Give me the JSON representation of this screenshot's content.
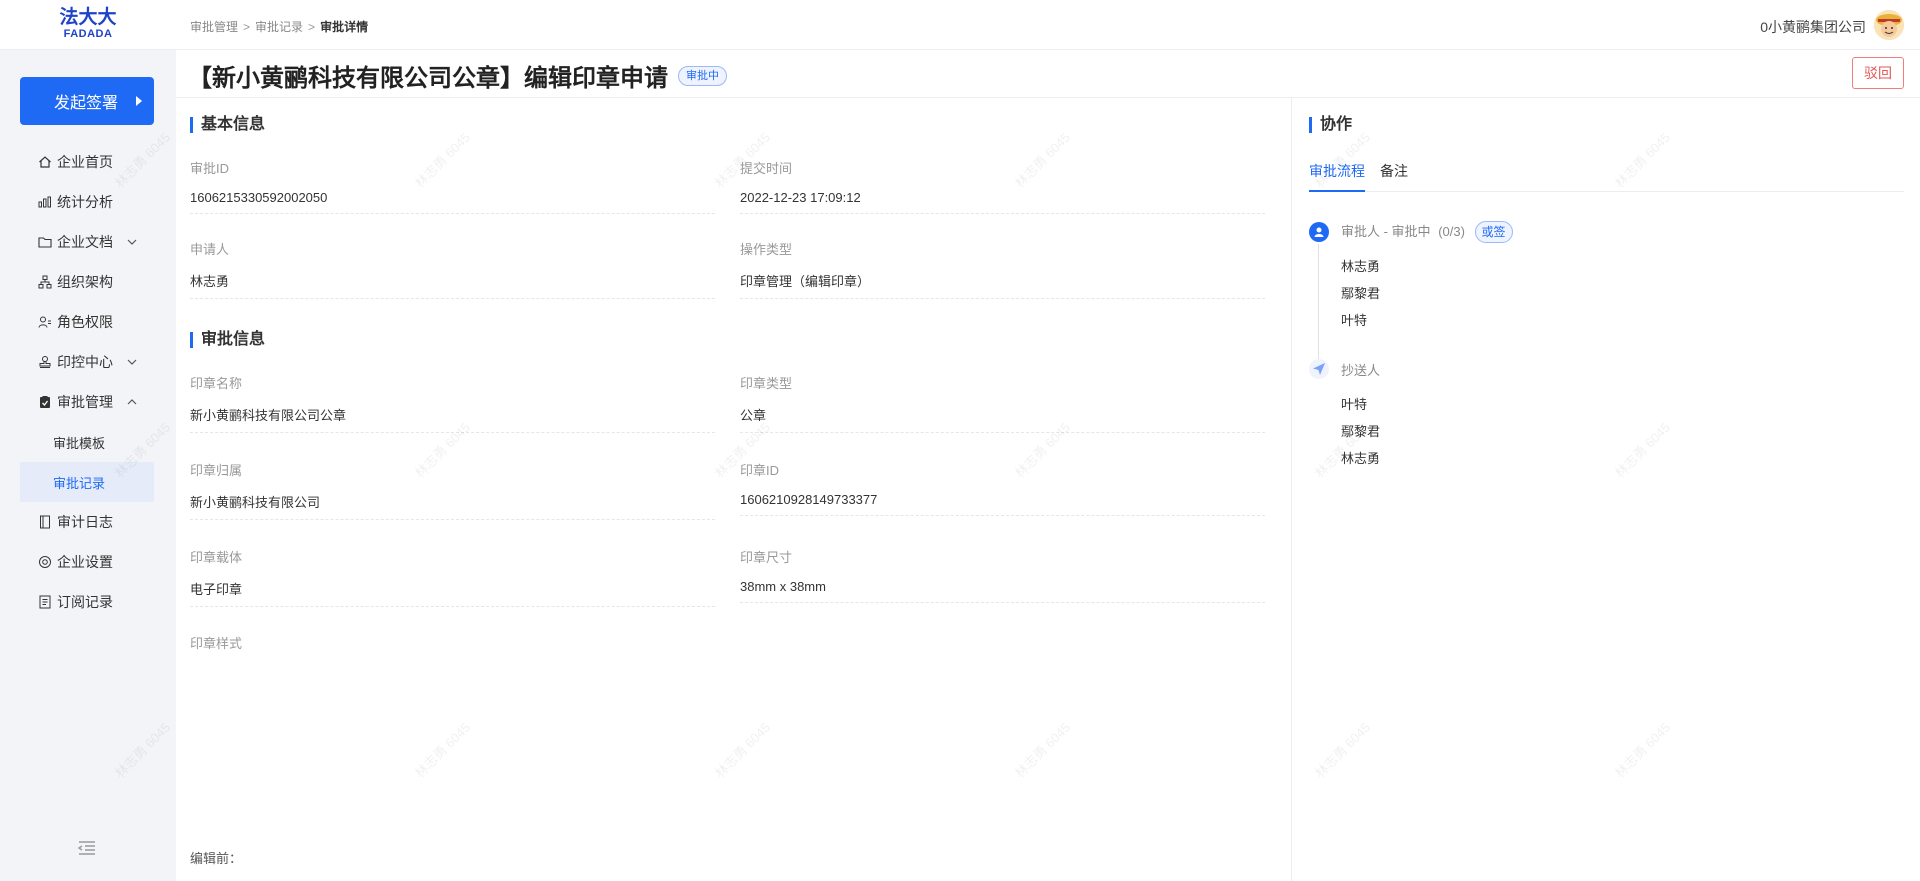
{
  "brand": {
    "cn": "法大大",
    "en": "FADADA"
  },
  "breadcrumb": [
    "审批管理",
    "审批记录",
    "审批详情"
  ],
  "header": {
    "company": "0小黄鹂集团公司"
  },
  "sidebar": {
    "start_button": "发起签署",
    "items": [
      {
        "label": "企业首页",
        "icon": "home-icon"
      },
      {
        "label": "统计分析",
        "icon": "chart-icon"
      },
      {
        "label": "企业文档",
        "icon": "folder-icon",
        "chevron": "down"
      },
      {
        "label": "组织架构",
        "icon": "org-icon"
      },
      {
        "label": "角色权限",
        "icon": "role-icon"
      },
      {
        "label": "印控中心",
        "icon": "stamp-icon",
        "chevron": "down"
      },
      {
        "label": "审批管理",
        "icon": "approval-icon",
        "chevron": "up"
      },
      {
        "label": "审批模板",
        "sub": true
      },
      {
        "label": "审批记录",
        "sub": true,
        "active": true
      },
      {
        "label": "审计日志",
        "icon": "log-icon"
      },
      {
        "label": "企业设置",
        "icon": "settings-icon"
      },
      {
        "label": "订阅记录",
        "icon": "subscription-icon"
      }
    ]
  },
  "page": {
    "title": "【新小黄鹂科技有限公司公章】编辑印章申请",
    "status": "审批中",
    "reject": "驳回"
  },
  "basic": {
    "title": "基本信息",
    "approval_id_label": "审批ID",
    "approval_id": "1606215330592002050",
    "submit_time_label": "提交时间",
    "submit_time": "2022-12-23 17:09:12",
    "applicant_label": "申请人",
    "applicant": "林志勇",
    "op_type_label": "操作类型",
    "op_type": "印章管理（编辑印章）"
  },
  "approval": {
    "title": "审批信息",
    "seal_name_label": "印章名称",
    "seal_name": "新小黄鹂科技有限公司公章",
    "seal_type_label": "印章类型",
    "seal_type": "公章",
    "seal_owner_label": "印章归属",
    "seal_owner": "新小黄鹂科技有限公司",
    "seal_id_label": "印章ID",
    "seal_id": "1606210928149733377",
    "seal_carrier_label": "印章载体",
    "seal_carrier": "电子印章",
    "seal_size_label": "印章尺寸",
    "seal_size": "38mm x 38mm",
    "seal_style_label": "印章样式",
    "before_edit_label": "编辑前："
  },
  "collab": {
    "title": "协作",
    "tabs": [
      "审批流程",
      "备注"
    ],
    "approver_title": "审批人 - 审批中",
    "approver_progress": "(0/3)",
    "approver_mode": "或签",
    "approvers": [
      "林志勇",
      "鄢黎君",
      "叶特"
    ],
    "cc_title": "抄送人",
    "cc": [
      "叶特",
      "鄢黎君",
      "林志勇"
    ]
  },
  "watermark": "林志勇 6045",
  "colors": {
    "primary": "#1f6af5",
    "danger": "#e45656",
    "brand": "#1f43c8"
  }
}
